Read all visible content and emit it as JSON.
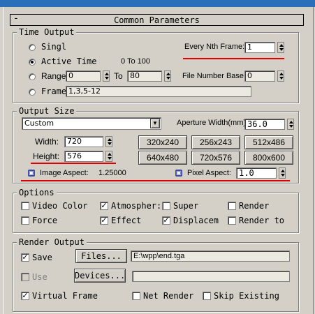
{
  "rollout": {
    "title": "Common Parameters",
    "collapse_symbol": "-"
  },
  "time_output": {
    "label": "Time Output",
    "single": "Singl",
    "active_time": "Active Time",
    "active_range": "0 To 100",
    "range": "Range",
    "range_from": "0",
    "range_to_label": "To",
    "range_to": "80",
    "frames": "Frame",
    "frames_value": "1,3,5-12",
    "every_nth_label": "Every Nth Frame:",
    "every_nth_value": "1",
    "file_base_label": "File Number Base:",
    "file_base_value": "0",
    "selected": "active_time"
  },
  "output_size": {
    "label": "Output Size",
    "preset": "Custom",
    "aperture_label": "Aperture Width(mm):",
    "aperture_value": "36.0",
    "width_label": "Width:",
    "width_value": "720",
    "height_label": "Height:",
    "height_value": "576",
    "presets": [
      "320x240",
      "256x243",
      "512x486",
      "640x480",
      "720x576",
      "800x600"
    ],
    "image_aspect_label": "Image Aspect:",
    "image_aspect_value": "1.25000",
    "pixel_aspect_label": "Pixel Aspect:",
    "pixel_aspect_value": "1.0"
  },
  "options": {
    "label": "Options",
    "video_color": "Video Color",
    "atmospheric": "Atmospher:",
    "super_black": "Super",
    "render_hidden": "Render",
    "force_2sided": "Force",
    "effects": "Effect",
    "displacement": "Displacem",
    "render_to_fields": "Render to"
  },
  "render_output": {
    "label": "Render Output",
    "save": "Save",
    "files_button": "Files...",
    "file_path": "E:\\wpp\\end.tga",
    "use": "Use",
    "devices_button": "Devices...",
    "virtual_frame": "Virtual Frame",
    "net_render": "Net Render",
    "skip_existing": "Skip Existing"
  },
  "colors": {
    "annotation_red": "#e00000",
    "panel": "#d4d0c8",
    "titlebar": "#2a6fb8"
  }
}
